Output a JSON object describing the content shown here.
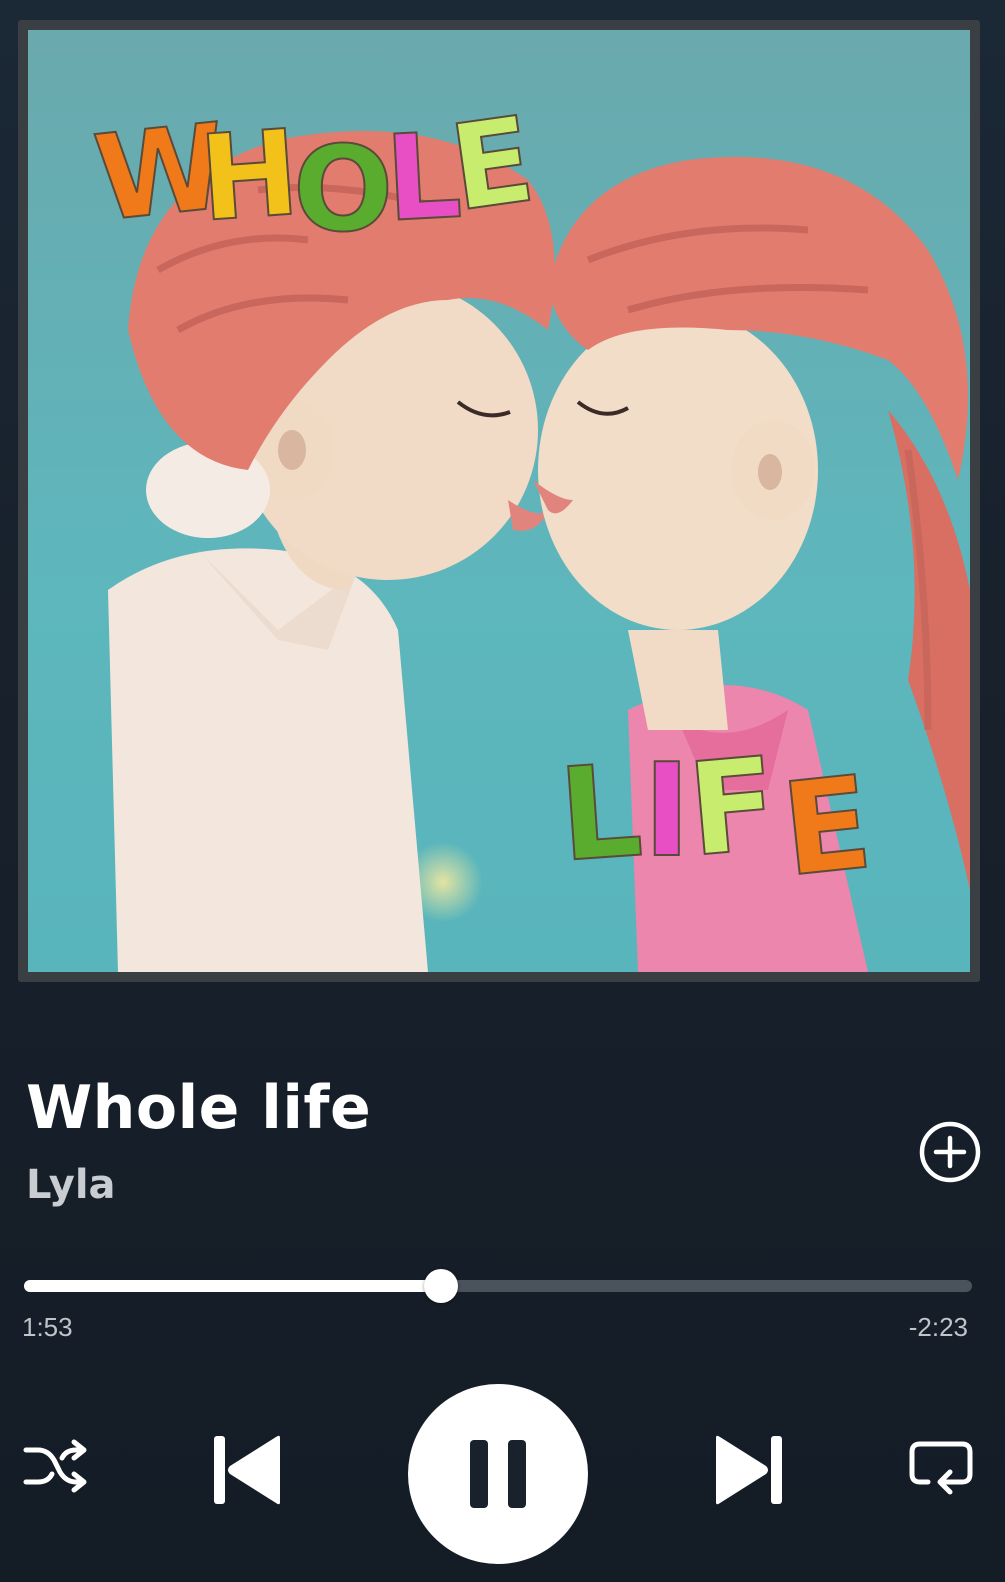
{
  "album_art": {
    "alt": "Whole life album cover",
    "cover_text_top": "WHOLE",
    "cover_text_bottom": "LIFE",
    "letter_colors": [
      "#f07a1a",
      "#f3c21a",
      "#5aac2e",
      "#e84fc4",
      "#c8ec6e"
    ]
  },
  "track": {
    "title": "Whole life",
    "artist": "Lyla"
  },
  "playback": {
    "elapsed": "1:53",
    "remaining": "-2:23",
    "progress": 0.44,
    "state": "playing"
  },
  "controls": {
    "shuffle_icon": "shuffle-icon",
    "previous_icon": "skip-previous-icon",
    "play_pause_icon": "pause-icon",
    "next_icon": "skip-next-icon",
    "repeat_icon": "repeat-icon",
    "add_icon": "add-circle-icon"
  },
  "colors": {
    "background": "#18212c",
    "track_bg": "#4a525b",
    "accent": "#ffffff"
  }
}
